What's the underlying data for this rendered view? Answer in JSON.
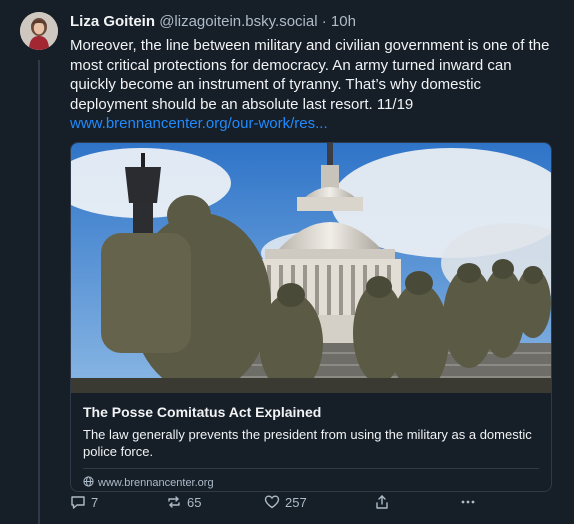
{
  "post": {
    "author_name": "Liza Goitein",
    "handle": "@lizagoitein.bsky.social",
    "separator": "·",
    "timestamp": "10h",
    "text": "Moreover, the line between military and civilian government is one of the most critical protections for democracy. An army turned inward can quickly become an instrument of tyranny. That’s why domestic deployment should be an absolute last resort. 11/19",
    "link_text": "www.brennancenter.org/our-work/res..."
  },
  "link_card": {
    "title": "The Posse Comitatus Act Explained",
    "description": "The law generally prevents the president from using the military as a domestic police force.",
    "source": "www.brennancenter.org",
    "image_subject": "National Guard soldiers walking toward the U.S. Capitol dome"
  },
  "actions": {
    "replies": "7",
    "reposts": "65",
    "likes": "257"
  },
  "icons": [
    "globe-icon",
    "reply-icon",
    "repost-icon",
    "like-icon",
    "share-icon",
    "more-icon"
  ],
  "colors": {
    "background": "#161e27",
    "text": "#f1f3f5",
    "muted": "#aebbc9",
    "link": "#208bfe",
    "border": "#2e3a48"
  }
}
